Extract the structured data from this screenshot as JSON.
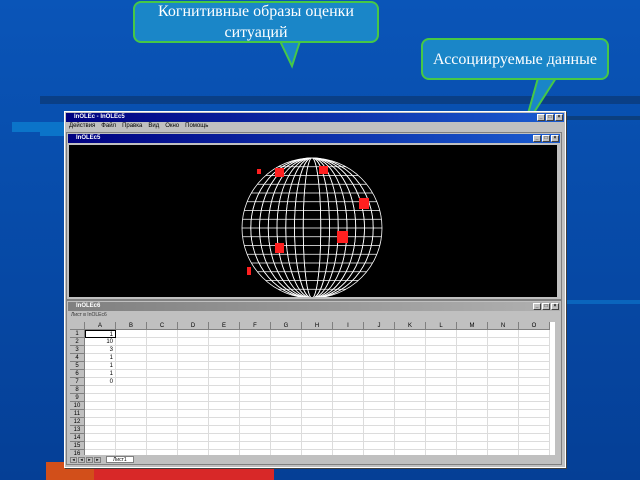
{
  "callouts": {
    "cognitive": "Когнитивные образы оценки ситуаций",
    "associated": "Ассоциируемые данные"
  },
  "app": {
    "title": "InOLEc - InOLEc5",
    "menu": [
      "Действия",
      "Файл",
      "Правка",
      "Вид",
      "Окно",
      "Помощь"
    ]
  },
  "graph_window": {
    "title": "InOLEc5",
    "sphere_color": "#ffffff",
    "marker_color": "#ff2020",
    "background": "#000000"
  },
  "sheet_window": {
    "title": "InOLEc6",
    "formula_text": "Лист в InOLEc6",
    "columns": [
      "A",
      "B",
      "C",
      "D",
      "E",
      "F",
      "G",
      "H",
      "I",
      "J",
      "K",
      "L",
      "M",
      "N",
      "O"
    ],
    "rows": [
      "1",
      "2",
      "3",
      "4",
      "5",
      "6",
      "7",
      "8",
      "9",
      "10",
      "11",
      "12",
      "13",
      "14",
      "15",
      "16"
    ],
    "column_a_values": [
      "1",
      "10",
      "3",
      "1",
      "1",
      "1",
      "0"
    ],
    "sheet_tab": "Лист1"
  },
  "colors": {
    "callout_fill": "#1a86c8",
    "callout_border": "#46c846",
    "title_active": "#000080"
  }
}
